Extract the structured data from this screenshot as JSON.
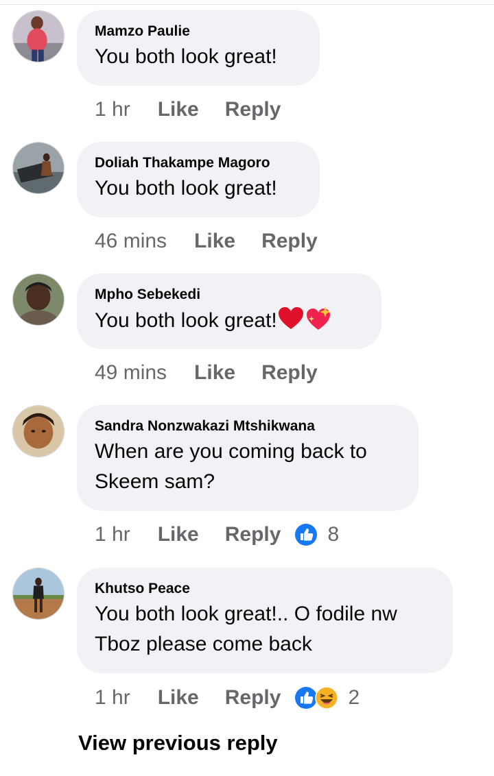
{
  "comments": [
    {
      "author": "Mamzo Paulie",
      "text": "You both look great!",
      "time": "1 hr",
      "like_label": "Like",
      "reply_label": "Reply"
    },
    {
      "author": "Doliah Thakampe Magoro",
      "text": "You both look great!",
      "time": "46 mins",
      "like_label": "Like",
      "reply_label": "Reply"
    },
    {
      "author": "Mpho Sebekedi",
      "text": "You both look great!",
      "text_emojis": [
        "red-heart",
        "sparkling-heart"
      ],
      "time": "49 mins",
      "like_label": "Like",
      "reply_label": "Reply"
    },
    {
      "author": "Sandra Nonzwakazi Mtshikwana",
      "text_line1": "When are you coming back to",
      "text_line2": "Skeem sam?",
      "time": "1 hr",
      "like_label": "Like",
      "reply_label": "Reply",
      "reactions": [
        "like-reaction"
      ],
      "reaction_count": "8"
    },
    {
      "author": "Khutso Peace",
      "text_line1": "You both look great!.. O fodile nw",
      "text_line2": "Tboz please come back",
      "time": "1 hr",
      "like_label": "Like",
      "reply_label": "Reply",
      "reactions": [
        "like-reaction",
        "haha-reaction"
      ],
      "reaction_count": "2"
    }
  ],
  "view_previous_label": "View previous reply",
  "colors": {
    "bubble": "#f0f2f5",
    "meta_text": "#65676b",
    "like_blue": "#1877f2",
    "haha_yellow": "#f7b125",
    "heart_red": "#e0112b"
  }
}
